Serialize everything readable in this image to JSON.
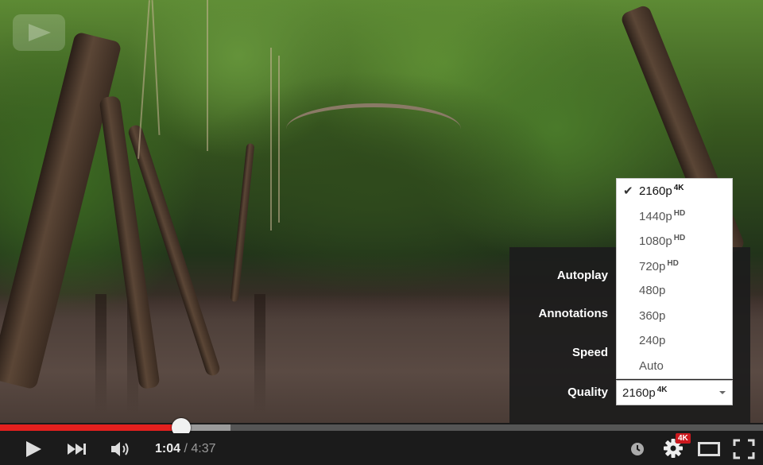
{
  "player": {
    "current_time": "1:04",
    "separator": "/",
    "duration": "4:37",
    "progress_played_fraction": 0.237,
    "progress_buffered_fraction": 0.302,
    "settings_badge": "4K"
  },
  "settings_menu": {
    "autoplay_label": "Autoplay",
    "annotations_label": "Annotations",
    "speed_label": "Speed",
    "quality_label": "Quality",
    "quality_selected": {
      "label": "2160p",
      "badge": "4K"
    },
    "quality_options": [
      {
        "label": "2160p",
        "badge": "4K",
        "selected": true
      },
      {
        "label": "1440p",
        "badge": "HD",
        "selected": false
      },
      {
        "label": "1080p",
        "badge": "HD",
        "selected": false
      },
      {
        "label": "720p",
        "badge": "HD",
        "selected": false
      },
      {
        "label": "480p",
        "badge": "",
        "selected": false
      },
      {
        "label": "360p",
        "badge": "",
        "selected": false
      },
      {
        "label": "240p",
        "badge": "",
        "selected": false
      },
      {
        "label": "Auto",
        "badge": "",
        "selected": false
      }
    ]
  },
  "icons": [
    "play-icon",
    "next-icon",
    "volume-icon",
    "watch-later-icon",
    "settings-gear-icon",
    "theater-mode-icon",
    "fullscreen-icon",
    "checkmark-icon",
    "chevron-down-icon"
  ],
  "colors": {
    "accent": "#e5201e",
    "badge": "#cc181e",
    "control_bar": "#1b1b1b"
  }
}
